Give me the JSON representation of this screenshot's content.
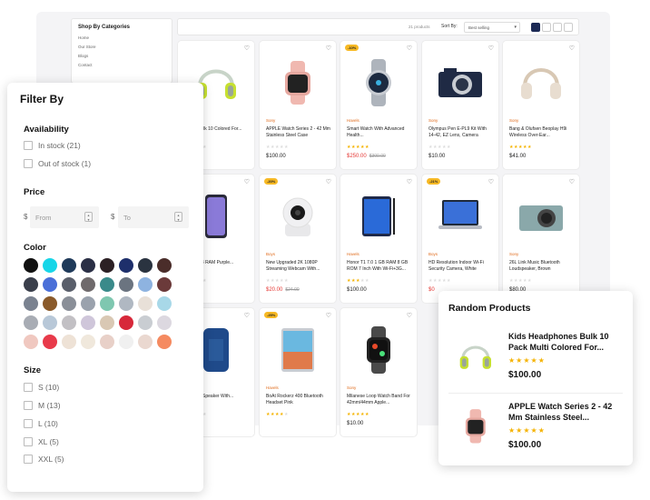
{
  "sidebar_categories": {
    "title": "Shop By Categories",
    "items": [
      "Home",
      "Our Store",
      "Blogs",
      "Contact"
    ]
  },
  "toolbar": {
    "count": "21 products",
    "sort_label": "Sort By:",
    "sort_value": "Best selling"
  },
  "products": [
    {
      "brand": "",
      "name": "hones Bulk 10 Colored For...",
      "price": "",
      "old": "",
      "badge": "",
      "stars": 0,
      "img": "headphone-lime",
      "sale": false
    },
    {
      "brand": "Sony",
      "name": "APPLE Watch Series 2 - 42 Mm Stainless Steel Case",
      "price": "$100.00",
      "old": "",
      "badge": "",
      "stars": 0,
      "img": "watch-pink",
      "sale": false
    },
    {
      "brand": "Havels",
      "name": "Smart Watch With Advanced Health...",
      "price": "$250.00",
      "old": "$300.00",
      "badge": "-10%",
      "stars": 5,
      "img": "watch-silver",
      "sale": true
    },
    {
      "brand": "Sony",
      "name": "Olympus Pen E-PL9 Kit With 14-42, EZ Lens, Camera",
      "price": "$10.00",
      "old": "",
      "badge": "",
      "stars": 0,
      "img": "camera",
      "sale": false
    },
    {
      "brand": "Sony",
      "name": "Bang & Olufsen Beoplay H9i Wireless Over-Ear...",
      "price": "$41.00",
      "old": "",
      "badge": "",
      "stars": 5,
      "img": "headphone-beige",
      "sale": false
    },
    {
      "brand": "",
      "name": "alaxy A23 RAM Purple...",
      "price": "",
      "old": "5.00",
      "badge": "",
      "stars": 0,
      "img": "phone",
      "sale": false
    },
    {
      "brand": "Boys",
      "name": "New Upgraded 2K 1080P Streaming Webcam With...",
      "price": "$20.00",
      "old": "$24.00",
      "badge": "-20%",
      "stars": 0,
      "img": "webcam",
      "sale": true
    },
    {
      "brand": "Havels",
      "name": "Honor T1 7.0 1 GB RAM 8 GB ROM 7 Inch With Wi-Fi+3G...",
      "price": "$100.00",
      "old": "",
      "badge": "",
      "stars": 3,
      "img": "tablet",
      "sale": false
    },
    {
      "brand": "Boys",
      "name": "HD Resolution Indoor Wi-Fi Security Camera, White",
      "price": "$0",
      "old": "",
      "badge": "-21%",
      "stars": 0,
      "img": "laptop",
      "sale": true
    },
    {
      "brand": "Sony",
      "name": "26L Link Music Bluetooth Loudspeaker, Brown",
      "price": "$80.00",
      "old": "",
      "badge": "",
      "stars": 0,
      "img": "camera-teal",
      "sale": false
    },
    {
      "brand": "",
      "name": "Portable Speaker With...",
      "price": "",
      "old": "",
      "badge": "",
      "stars": 0,
      "img": "speaker",
      "sale": false
    },
    {
      "brand": "Havels",
      "name": "BoAt Rockerz 400 Bluetooth Headset Pink",
      "price": "",
      "old": "",
      "badge": "-25%",
      "stars": 4,
      "img": "ipad",
      "sale": false
    },
    {
      "brand": "Sony",
      "name": "Milanese Loop Watch Band For 42mm/44mm Apple...",
      "price": "$10.00",
      "old": "",
      "badge": "",
      "stars": 5,
      "img": "watch-black",
      "sale": false
    }
  ],
  "filter": {
    "title": "Filter By",
    "availability": {
      "label": "Availability",
      "options": [
        "In stock (21)",
        "Out of stock (1)"
      ]
    },
    "price": {
      "label": "Price",
      "currency": "$",
      "from_placeholder": "From",
      "to_placeholder": "To"
    },
    "color": {
      "label": "Color",
      "swatches": [
        "#111111",
        "#17d6e8",
        "#1f3a5a",
        "#2a2f45",
        "#2c2024",
        "#1e2f6b",
        "#2a3340",
        "#4a2d2a",
        "#3a3f4b",
        "#4a6fd8",
        "#5a5f6b",
        "#6f6a6c",
        "#3a8a8a",
        "#6b7480",
        "#8eb3e0",
        "#6b3a3a",
        "#7a8290",
        "#8a5a2a",
        "#8a8f98",
        "#9aa2ad",
        "#7fc7b0",
        "#b0b8c2",
        "#e8e0d8",
        "#a8d8e8",
        "#a8acb4",
        "#b8c8d8",
        "#c2c0c4",
        "#cfc6da",
        "#d9c8b4",
        "#d7283a",
        "#c9cdd2",
        "#dcd8e0",
        "#f0c8c0",
        "#e83a4a",
        "#eee2d6",
        "#f0e8dc",
        "#e8d0c8",
        "#f0f0f0",
        "#ead8d0",
        "#f58a60"
      ]
    },
    "size": {
      "label": "Size",
      "options": [
        "S (10)",
        "M (13)",
        "L (10)",
        "XL (5)",
        "XXL (5)"
      ]
    }
  },
  "random_products": {
    "title": "Random Products",
    "items": [
      {
        "name": "Kids Headphones Bulk 10 Pack Multi Colored For...",
        "price": "$100.00",
        "stars": 5,
        "img": "headphone-lime"
      },
      {
        "name": "APPLE Watch Series 2 - 42 Mm Stainless Steel...",
        "price": "$100.00",
        "stars": 5,
        "img": "watch-pink"
      }
    ]
  }
}
